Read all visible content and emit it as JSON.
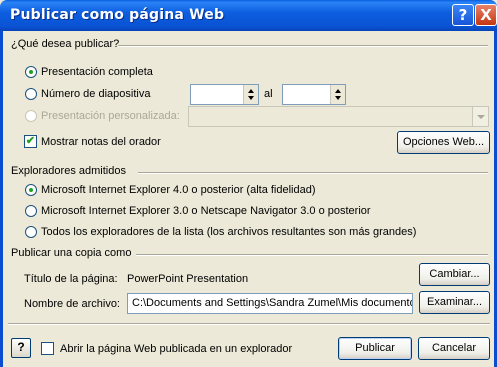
{
  "window": {
    "title": "Publicar como página Web"
  },
  "titlebar_buttons": {
    "help": "?",
    "close": "X"
  },
  "publish_group": {
    "label": "¿Qué desea publicar?",
    "option_complete": "Presentación completa",
    "option_slide_number": "Número de diapositiva",
    "slide_from": "",
    "al_label": "al",
    "slide_to": "",
    "option_custom": "Presentación personalizada:",
    "custom_value": "",
    "show_notes": "Mostrar notas del orador",
    "show_notes_checked": true,
    "web_options_button": "Opciones Web..."
  },
  "browsers_group": {
    "label": "Exploradores admitidos",
    "option_ie4": "Microsoft Internet Explorer 4.0 o posterior (alta fidelidad)",
    "option_ie3": "Microsoft Internet Explorer 3.0 o Netscape Navigator 3.0 o posterior",
    "option_all": "Todos los exploradores de la lista (los archivos resultantes son más grandes)"
  },
  "copy_group": {
    "label": "Publicar una copia como",
    "page_title_label": "Título de la página:",
    "page_title_value": "PowerPoint Presentation",
    "change_button": "Cambiar...",
    "filename_label": "Nombre de archivo:",
    "filename_value": "C:\\Documents and Settings\\Sandra Zumel\\Mis documentos",
    "browse_button": "Examinar..."
  },
  "footer": {
    "help_icon": "?",
    "open_in_browser": "Abrir la página Web publicada en un explorador",
    "publish_button": "Publicar",
    "cancel_button": "Cancelar"
  },
  "colors": {
    "titlebar": "#0a53d4",
    "dialog_bg": "#ece9d8",
    "radio_dot": "#21a121"
  }
}
